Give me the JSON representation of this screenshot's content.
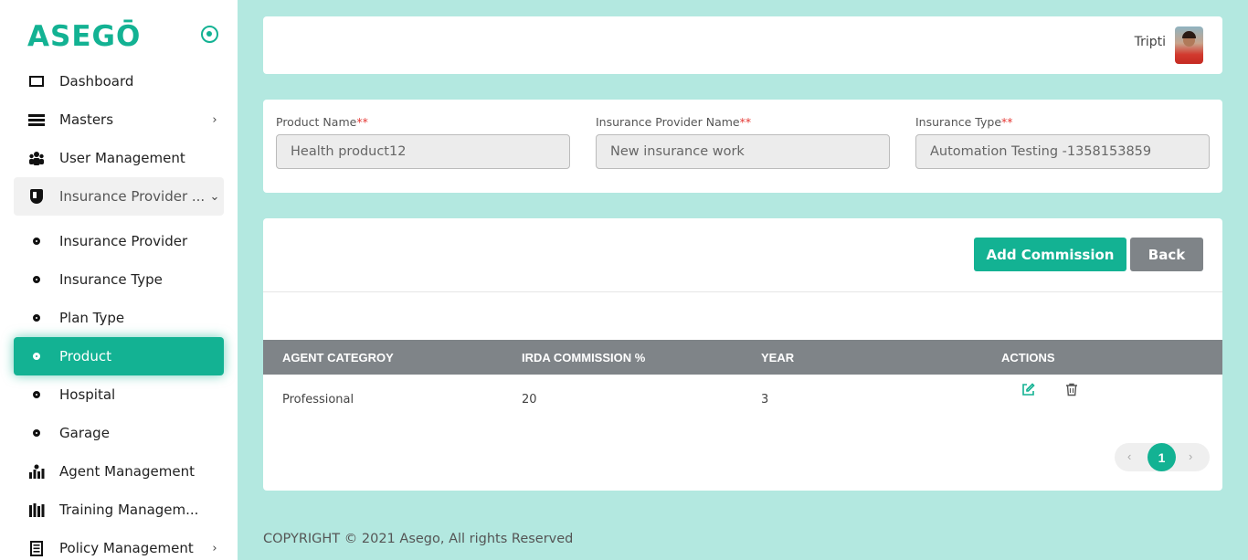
{
  "app": {
    "logo": "ASEGŌ"
  },
  "sidebar": {
    "items": [
      {
        "label": "Dashboard",
        "icon": "dashboard-icon"
      },
      {
        "label": "Masters",
        "icon": "list-icon",
        "chevron": "›"
      },
      {
        "label": "User Management",
        "icon": "users-icon"
      },
      {
        "label": "Insurance Provider ...",
        "icon": "shield-icon",
        "chevron": "⌄"
      },
      {
        "label": "Insurance Provider",
        "icon": "dot-icon"
      },
      {
        "label": "Insurance Type",
        "icon": "dot-icon"
      },
      {
        "label": "Plan Type",
        "icon": "dot-icon"
      },
      {
        "label": "Product",
        "icon": "dot-icon",
        "active": true
      },
      {
        "label": "Hospital",
        "icon": "dot-icon"
      },
      {
        "label": "Garage",
        "icon": "dot-icon"
      },
      {
        "label": "Agent Management",
        "icon": "agent-icon"
      },
      {
        "label": "Training Managem...",
        "icon": "training-icon"
      },
      {
        "label": "Policy Management",
        "icon": "policy-icon",
        "chevron": "›"
      }
    ]
  },
  "header": {
    "user_name": "Tripti"
  },
  "filters": {
    "product_label": "Product Name",
    "product_value": "Health product12",
    "provider_label": "Insurance Provider Name",
    "provider_value": "New insurance work",
    "type_label": "Insurance Type",
    "type_value": "Automation Testing -1358153859",
    "required_mark": "**"
  },
  "table": {
    "add_button": "Add Commission",
    "back_button": "Back",
    "columns": [
      "AGENT CATEGROY",
      "IRDA COMMISSION %",
      "YEAR",
      "ACTIONS"
    ],
    "rows": [
      {
        "agent_category": "Professional",
        "commission": "20",
        "year": "3"
      }
    ],
    "pagination": {
      "prev": "‹",
      "current": "1",
      "next": "›"
    }
  },
  "footer": {
    "text": "COPYRIGHT © 2021 Asego, All rights Reserved"
  },
  "colors": {
    "accent": "#13b293",
    "gray": "#7f8488",
    "background": "#b3e8e0"
  }
}
